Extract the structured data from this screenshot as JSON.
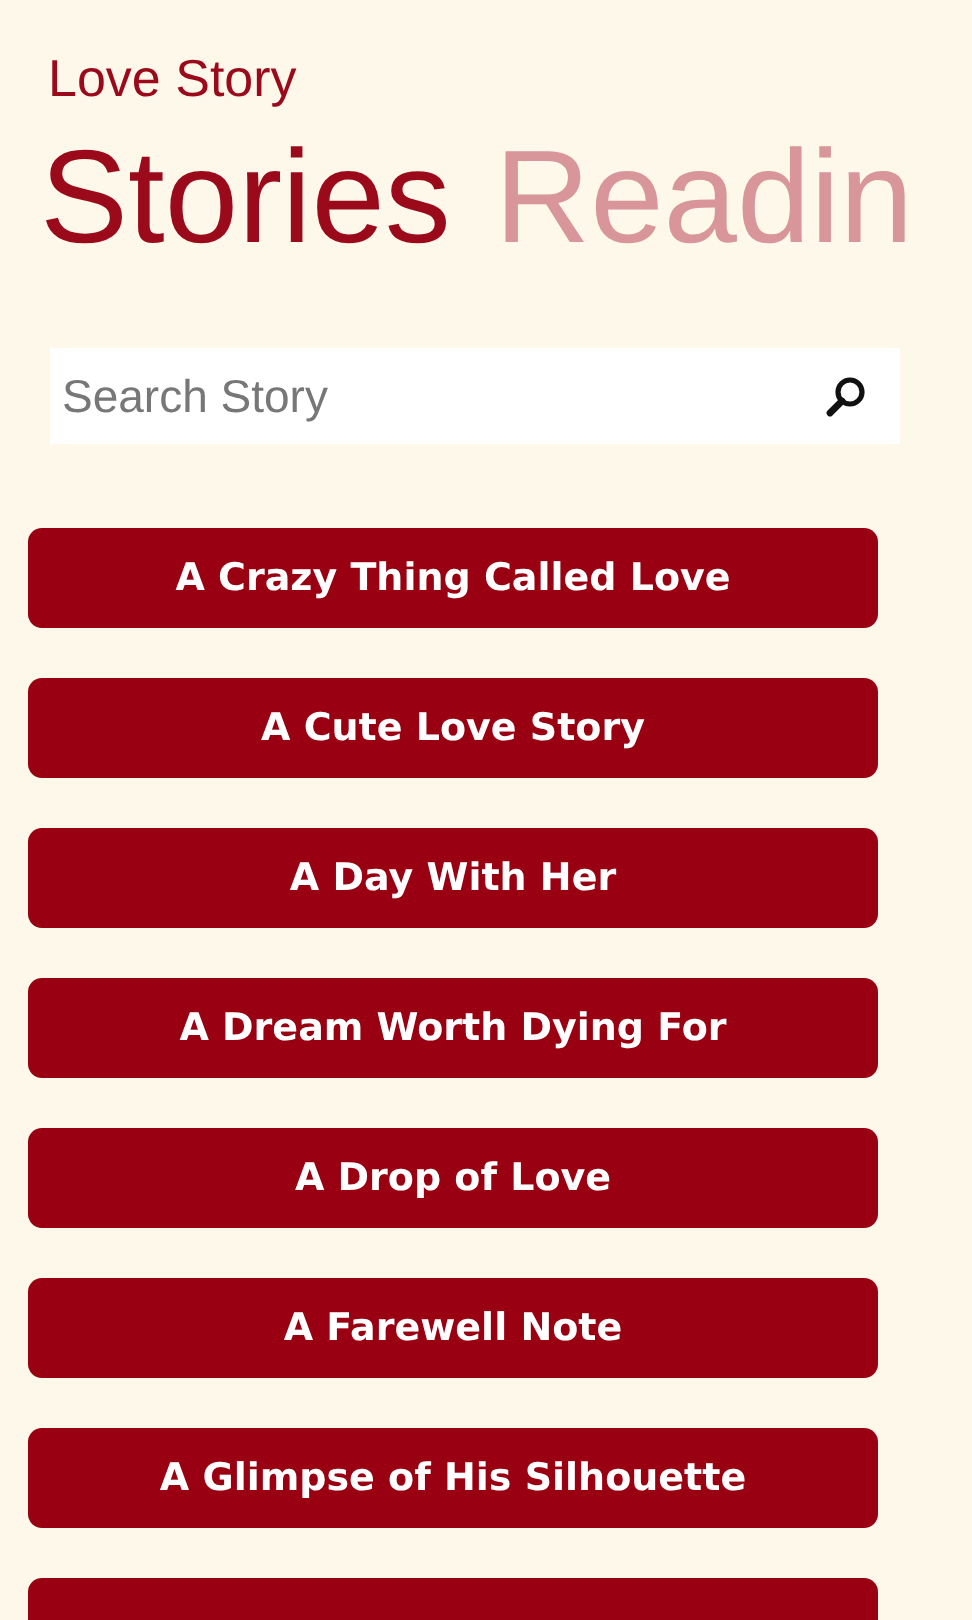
{
  "app_title": "Love Story",
  "pivots": [
    {
      "label": "Stories",
      "selected": true
    },
    {
      "label": "Readin",
      "selected": false
    }
  ],
  "search": {
    "placeholder": "Search Story"
  },
  "stories": [
    {
      "title": "A Crazy Thing Called Love"
    },
    {
      "title": "A Cute Love Story"
    },
    {
      "title": "A Day With Her"
    },
    {
      "title": "A Dream Worth Dying For"
    },
    {
      "title": "A Drop of Love"
    },
    {
      "title": "A Farewell Note"
    },
    {
      "title": "A Glimpse of His Silhouette"
    }
  ],
  "more_below": true
}
